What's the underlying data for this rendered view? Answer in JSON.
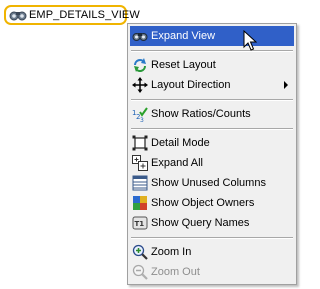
{
  "node": {
    "label": "EMP_DETAILS_VIEW",
    "icon": "view-binoculars-icon"
  },
  "menu": {
    "items": [
      {
        "label": "Expand View",
        "icon": "binoculars-icon",
        "state": "highlighted"
      },
      {
        "label": "Reset Layout",
        "icon": "reset-layout-icon"
      },
      {
        "label": "Layout Direction",
        "icon": "move-arrows-icon",
        "submenu": true
      },
      {
        "label": "Show Ratios/Counts",
        "icon": "ratios-counts-icon"
      },
      {
        "label": "Detail Mode",
        "icon": "detail-mode-icon"
      },
      {
        "label": "Expand All",
        "icon": "expand-all-icon"
      },
      {
        "label": "Show Unused Columns",
        "icon": "unused-columns-icon"
      },
      {
        "label": "Show Object Owners",
        "icon": "object-owners-icon"
      },
      {
        "label": "Show Query Names",
        "icon": "query-names-icon"
      },
      {
        "label": "Zoom In",
        "icon": "zoom-in-icon"
      },
      {
        "label": "Zoom Out",
        "icon": "zoom-out-icon",
        "state": "disabled"
      }
    ]
  },
  "colors": {
    "highlight": "#3060c8",
    "node_border": "#f0b400",
    "menu_bg": "#f0f0f0"
  }
}
